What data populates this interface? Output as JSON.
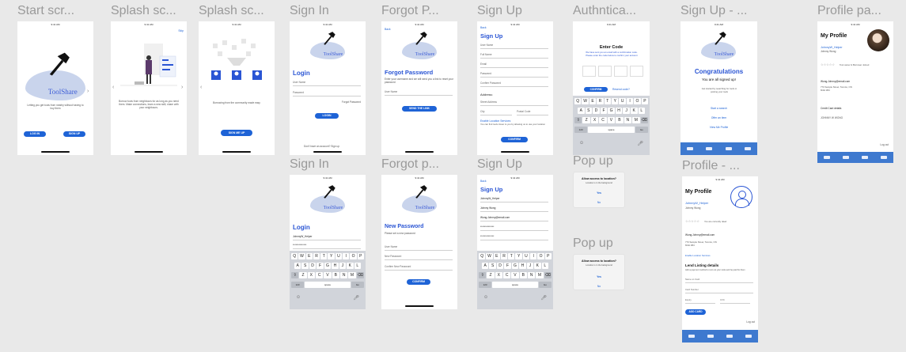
{
  "frames": {
    "start": {
      "title": "Start scr...",
      "logo_word": "ToolShare",
      "body": "Letting you get tools from nearby without having to buy them",
      "login": "LOG IN",
      "signup": "SIGN UP"
    },
    "splash1": {
      "title": "Splash sc...",
      "skip": "Skip",
      "body": "Borrow tools from neighbours for as long as you need them. Make connections, learn a new skill, share with your neighbours."
    },
    "splash2": {
      "title": "Splash sc...",
      "body": "Borrowing from the community made easy",
      "signup": "SIGN ME UP"
    },
    "signin1": {
      "title": "Sign In",
      "logo_word": "ToolShare",
      "heading": "Login",
      "username": "User Name",
      "password": "Password",
      "forgot": "Forgot Password",
      "login": "LOGIN",
      "footer": "Don't have an account? Sign up"
    },
    "forgot1": {
      "title": "Forgot P...",
      "back": "Back",
      "logo_word": "ToolShare",
      "heading": "Forgot Password",
      "body": "Enter your username and we will send you a link to reset your password",
      "username": "User Name",
      "send": "SEND THE LINK"
    },
    "signup1": {
      "title": "Sign Up",
      "back": "Back",
      "heading": "Sign Up",
      "fields": [
        "User Name",
        "Full Name",
        "Email",
        "Password",
        "Confirm Password"
      ],
      "address_label": "Address:",
      "street": "Street Address",
      "city": "City",
      "postal": "Postal Code",
      "enable": "Enable Location Services",
      "enable_body": "You can find tools closer to you by allowing us to use your location",
      "confirm": "CONFIRM"
    },
    "auth": {
      "title": "Authntica...",
      "heading": "Enter Code",
      "body": "We have sent you an email with a confirmation code. Please enter the code below to confirm your account",
      "confirm": "CONFIRM",
      "resend": "Resend code?",
      "keys1": [
        "Q",
        "W",
        "E",
        "R",
        "T",
        "Y",
        "U",
        "I",
        "O",
        "P"
      ],
      "keys2": [
        "A",
        "S",
        "D",
        "F",
        "G",
        "H",
        "J",
        "K",
        "L"
      ],
      "keys3": [
        "Z",
        "X",
        "C",
        "V",
        "B",
        "N",
        "M"
      ],
      "num": "123",
      "space": "space",
      "go": "Go"
    },
    "signupdone": {
      "title": "Sign Up - ...",
      "logo_word": "ToolShare",
      "heading": "Congratulations",
      "sub": "You are all signed up!",
      "body": "Get started by searching for tools or posting your tools",
      "link1": "Start a search",
      "link2": "Offer an item",
      "link3": "View Me Profile"
    },
    "profile1": {
      "title": "Profile pa...",
      "heading": "My Profile",
      "name": "JohnnyW_Helper",
      "role": "Johnny Wong",
      "rating": "Tool owner & Borrower Joined",
      "email": "Wong.Johnny@email.com",
      "address": "770 Sample Street, Toronto, ON M4H 1B4",
      "card_label": "Credit Card details",
      "card_name": "JOHNNY W WONG",
      "logout": "Log out"
    },
    "signin2": {
      "title": "Sign In",
      "logo_word": "ToolShare",
      "heading": "Login",
      "username": "JohnnyW_Helper",
      "password": "**************",
      "num": "123",
      "space": "space",
      "go": "Go"
    },
    "forgot2": {
      "title": "Forgot p...",
      "logo_word": "ToolShare",
      "heading": "New Password",
      "body": "Please set a new password",
      "username": "User Name",
      "newpass": "New Password",
      "confirmpass": "Confirm New Password",
      "confirm": "CONFIRM"
    },
    "signup2": {
      "title": "Sign Up",
      "back": "Back",
      "heading": "Sign Up",
      "fields": [
        "JohnnyW_Helper",
        "Johnny Wong",
        "Wong.Johnny@email.com",
        "**************",
        "**************"
      ],
      "num": "123",
      "space": "space",
      "go": "Go"
    },
    "popup1": {
      "title": "Pop up",
      "question": "Allow access to location?",
      "sub": "Location is in the background",
      "yes": "Yes",
      "no": "No"
    },
    "popup2": {
      "title": "Pop up",
      "question": "Allow access to location?",
      "sub": "Location is in the background",
      "yes": "Yes",
      "no": "No"
    },
    "profile2": {
      "title": "Profile - ...",
      "heading": "My Profile",
      "name": "JohnnyW_Helper",
      "role": "Johnny Wong",
      "rating": "You are currently rated",
      "email": "Wong.Johnny@email.com",
      "address": "770 Sample Street, Toronto, ON M4H 1B4",
      "enable": "Enable Location Services",
      "card_heading": "Lend Listing details",
      "card_body": "Add a payment method to rent out your tools and be paid for them",
      "card_name": "Name on Card",
      "card_number": "Card Number",
      "expiry": "Expiry",
      "cvc": "CVC",
      "add": "ADD CARD",
      "logout": "Log out"
    }
  },
  "colors": {
    "accent": "#1e63d6",
    "heading": "#2a55d4",
    "tabbar": "#3e79cf",
    "logo_blue": "#c9d4ec"
  }
}
